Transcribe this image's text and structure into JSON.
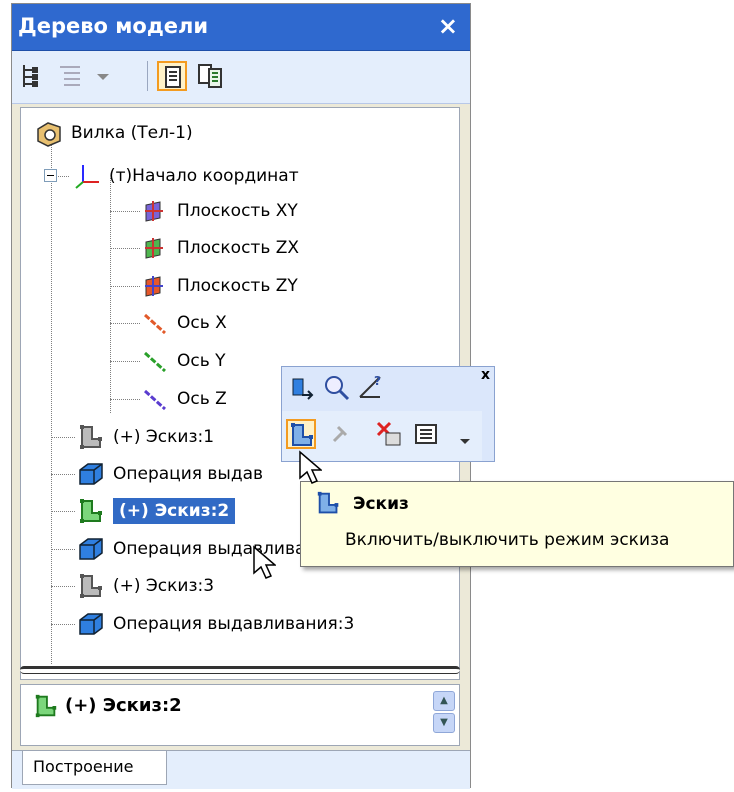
{
  "panel": {
    "title": "Дерево модели",
    "close_symbol": "×"
  },
  "toolbar": {
    "icons": [
      "tree-structure-icon",
      "filter-list-icon",
      "dropdown-arrow-icon",
      "single-pane-icon",
      "split-pane-icon"
    ]
  },
  "tree": {
    "items": [
      {
        "label": "Вилка (Тел-1)",
        "icon": "part-icon"
      },
      {
        "label": "(т)Начало координат",
        "icon": "origin-icon"
      },
      {
        "label": "Плоскость XY",
        "icon": "plane-xy-icon"
      },
      {
        "label": "Плоскость ZX",
        "icon": "plane-zx-icon"
      },
      {
        "label": "Плоскость ZY",
        "icon": "plane-zy-icon"
      },
      {
        "label": "Ось X",
        "icon": "axis-x-icon"
      },
      {
        "label": "Ось Y",
        "icon": "axis-y-icon"
      },
      {
        "label": "Ось Z",
        "icon": "axis-z-icon"
      },
      {
        "label": "(+) Эскиз:1",
        "icon": "sketch-icon"
      },
      {
        "label": "Операция выдав",
        "icon": "extrude-icon"
      },
      {
        "label": "(+) Эскиз:2",
        "icon": "sketch-active-icon",
        "selected": true
      },
      {
        "label": "Операция выдавливания:2",
        "icon": "extrude-icon"
      },
      {
        "label": "(+) Эскиз:3",
        "icon": "sketch-icon"
      },
      {
        "label": "Операция выдавливания:3",
        "icon": "extrude-icon"
      }
    ]
  },
  "bottom": {
    "label": "(+) Эскиз:2"
  },
  "tabs": {
    "active": "Построение"
  },
  "context_toolbar": {
    "close_symbol": "x",
    "icons": [
      "normal-to-icon",
      "zoom-icon",
      "properties-icon",
      "sketch-mode-icon",
      "pin-icon",
      "delete-icon",
      "settings-icon",
      "more-icon"
    ]
  },
  "tooltip": {
    "title": "Эскиз",
    "text": "Включить/выключить режим эскиза"
  },
  "colors": {
    "titlebar": "#2f69cf",
    "selection": "#316ac5",
    "tooltip_bg": "#ffffe1",
    "pressed_border": "#f39b20"
  }
}
